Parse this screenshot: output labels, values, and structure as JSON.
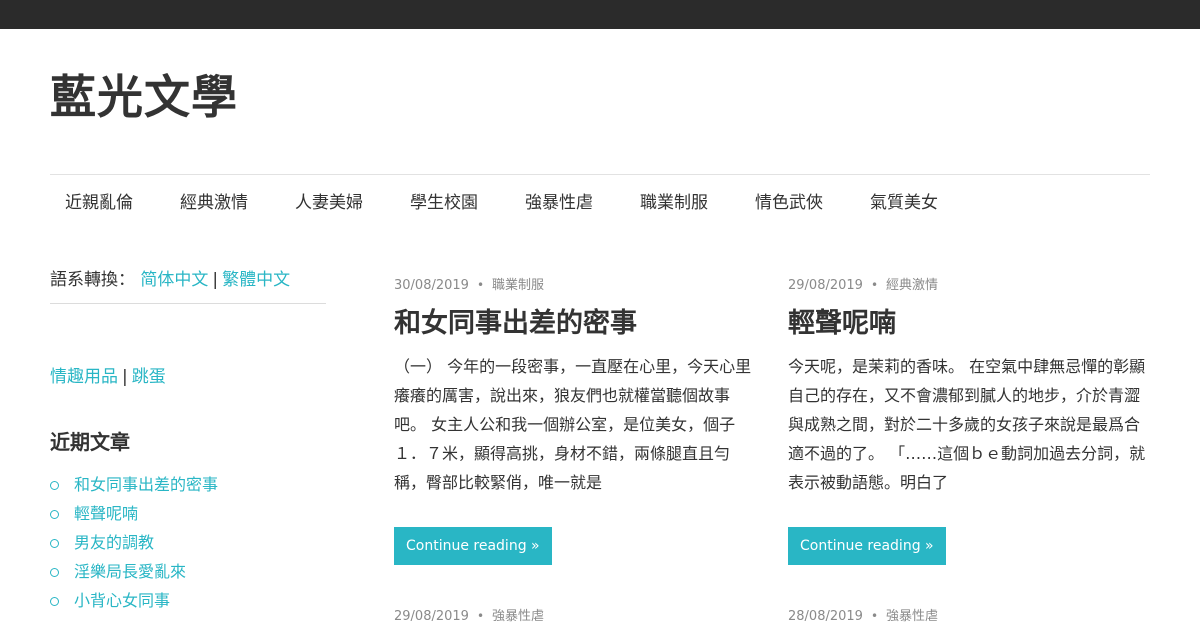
{
  "site": {
    "title": "藍光文學"
  },
  "nav": {
    "items": [
      "近親亂倫",
      "經典激情",
      "人妻美婦",
      "學生校園",
      "強暴性虐",
      "職業制服",
      "情色武俠",
      "氣質美女"
    ]
  },
  "sidebar": {
    "lang_label": "語系轉換：",
    "lang_simplified": "简体中文",
    "lang_separator": "|",
    "lang_traditional": "繁體中文",
    "toy_link_1": "情趣用品",
    "toy_separator": "|",
    "toy_link_2": "跳蛋",
    "recent_title": "近期文章",
    "recent_posts": [
      "和女同事出差的密事",
      "輕聲呢喃",
      "男友的調教",
      "淫樂局長愛亂來",
      "小背心女同事"
    ]
  },
  "posts": [
    {
      "date": "30/08/2019",
      "category": "職業制服",
      "title": "和女同事出差的密事",
      "excerpt": "（一） 今年的一段密事，一直壓在心里，今天心里癢癢的厲害，說出來，狼友們也就權當聽個故事吧。 女主人公和我一個辦公室，是位美女，個子１．７米，顯得高挑，身材不錯，兩條腿直且勻稱，臀部比較緊俏，唯一就是",
      "button": "Continue reading »"
    },
    {
      "date": "29/08/2019",
      "category": "經典激情",
      "title": "輕聲呢喃",
      "excerpt": "今天呢，是茉莉的香味。 在空氣中肆無忌憚的彰顯自己的存在，又不會濃郁到膩人的地步，介於青澀與成熟之間，對於二十多歲的女孩子來說是最爲合適不過的了。 「……這個ｂｅ動詞加過去分詞，就表示被動語態。明白了",
      "button": "Continue reading »"
    }
  ],
  "next_posts": [
    {
      "date": "29/08/2019",
      "category": "強暴性虐"
    },
    {
      "date": "28/08/2019",
      "category": "強暴性虐"
    }
  ],
  "meta_separator": "•",
  "colors": {
    "accent": "#29b6c5",
    "topbar": "#2b2b2b",
    "text": "#333333",
    "meta": "#8a8a8a"
  }
}
